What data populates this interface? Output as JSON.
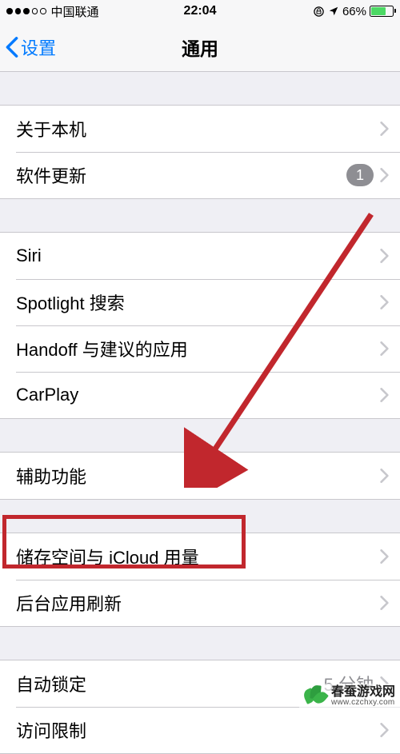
{
  "statusBar": {
    "carrier": "中国联通",
    "time": "22:04",
    "batteryPercent": "66%"
  },
  "nav": {
    "back": "设置",
    "title": "通用"
  },
  "groups": [
    {
      "cells": [
        {
          "label": "关于本机"
        },
        {
          "label": "软件更新",
          "badge": "1"
        }
      ]
    },
    {
      "cells": [
        {
          "label": "Siri"
        },
        {
          "label": "Spotlight 搜索"
        },
        {
          "label": "Handoff 与建议的应用"
        },
        {
          "label": "CarPlay"
        }
      ]
    },
    {
      "cells": [
        {
          "label": "辅助功能"
        }
      ]
    },
    {
      "cells": [
        {
          "label": "储存空间与 iCloud 用量"
        },
        {
          "label": "后台应用刷新"
        }
      ]
    },
    {
      "cells": [
        {
          "label": "自动锁定",
          "value": "5 分钟"
        },
        {
          "label": "访问限制"
        }
      ]
    }
  ],
  "watermark": {
    "name": "春蚕游戏网",
    "url": "www.czchxy.com"
  }
}
